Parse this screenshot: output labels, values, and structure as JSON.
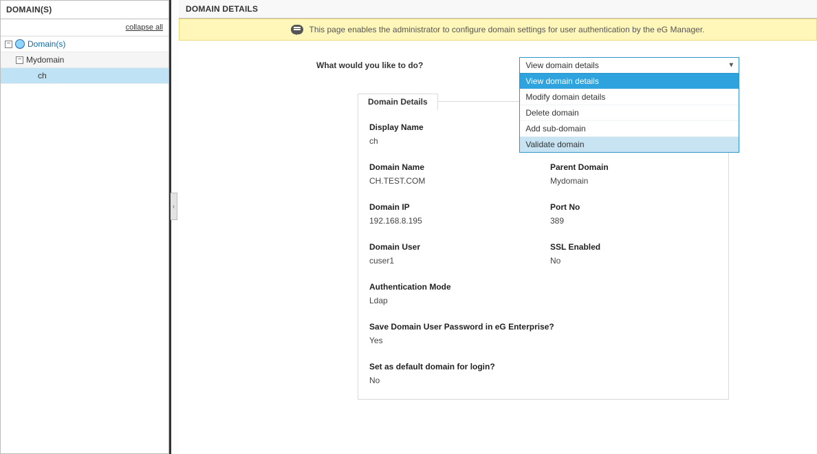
{
  "sidebar": {
    "title": "DOMAIN(S)",
    "collapse_all": "collapse all",
    "root_label": "Domain(s)",
    "level1_label": "Mydomain",
    "level2_label": "ch"
  },
  "main": {
    "header": "DOMAIN DETAILS",
    "banner": "This page enables the administrator to configure domain settings for user authentication by the eG Manager."
  },
  "action": {
    "label": "What would you like to do?",
    "selected": "View domain details",
    "options": [
      "View domain details",
      "Modify domain details",
      "Delete domain",
      "Add sub-domain",
      "Validate domain"
    ]
  },
  "details": {
    "tab_label": "Domain Details",
    "rows": {
      "display_name": {
        "label": "Display Name",
        "value": "ch"
      },
      "domain_name": {
        "label": "Domain Name",
        "value": "CH.TEST.COM"
      },
      "parent_domain": {
        "label": "Parent Domain",
        "value": "Mydomain"
      },
      "domain_ip": {
        "label": "Domain IP",
        "value": "192.168.8.195"
      },
      "port_no": {
        "label": "Port No",
        "value": "389"
      },
      "domain_user": {
        "label": "Domain User",
        "value": "cuser1"
      },
      "ssl_enabled": {
        "label": "SSL Enabled",
        "value": "No"
      },
      "auth_mode": {
        "label": "Authentication Mode",
        "value": "Ldap"
      },
      "save_pwd": {
        "label": "Save Domain User Password in eG Enterprise?",
        "value": "Yes"
      },
      "default_login": {
        "label": "Set as default domain for login?",
        "value": "No"
      }
    }
  }
}
